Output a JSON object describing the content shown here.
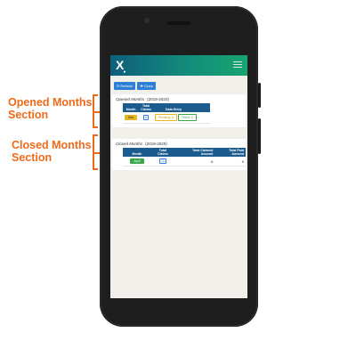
{
  "annotations": {
    "opened_label_line1": "Opened Months",
    "opened_label_line2": "Section",
    "closed_label_line1": "Closed Months",
    "closed_label_line2": "Section",
    "color": "#ee6a1b"
  },
  "app": {
    "logo": "X",
    "brand_colors": [
      "#0f5e7c",
      "#17a46f"
    ]
  },
  "toolbar": {
    "refresh_label": "Refresh",
    "close_label": "Close"
  },
  "opened": {
    "title": "Opened Months",
    "year": "(2019-2020)",
    "headers": {
      "month": "Month",
      "total_claims_line1": "Total",
      "total_claims_line2": "Claims",
      "data_entry": "Data Entry"
    },
    "rows": [
      {
        "month": "Mar",
        "claims": "8",
        "pending": "Pending: 6",
        "filled": "Filled: 2"
      }
    ]
  },
  "closed": {
    "title": "Closed Months",
    "year": "(2019-2020)",
    "headers": {
      "month": "Month",
      "total_claims_line1": "Total",
      "total_claims_line2": "Claims",
      "total_claimed_line1": "Total Claimed",
      "total_claimed_line2": "Amount",
      "total_paid_line1": "Total Paid",
      "total_paid_line2": "Amount"
    },
    "rows": [
      {
        "month": "April",
        "claims": "10",
        "claimed": "0",
        "paid": "0"
      }
    ]
  }
}
